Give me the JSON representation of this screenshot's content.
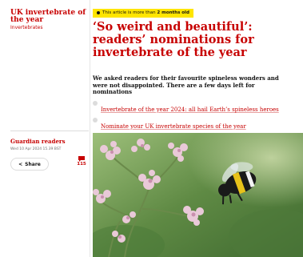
{
  "sidebar": {
    "series_title": "UK invertebrate of the year",
    "series_subtitle": "Invertebrates"
  },
  "meta": {
    "byline": "Guardian readers",
    "dateline": "Wed 10 Apr 2024 15.39 BST",
    "share_label": "Share",
    "share_icon": "share-icon",
    "comment_icon": "comment-icon",
    "comment_count": "115"
  },
  "article": {
    "notice": {
      "prefix": "This article is more than ",
      "emphasis": "2 months old"
    },
    "headline": "‘So weird and beautiful’: readers’ nominations for invertebrate of the year",
    "standfirst": "We asked readers for their favourite spineless wonders and were not disappointed. There are a few days left for nominations",
    "related_links": [
      {
        "label": "Invertebrate of the year 2024: all hail Earth’s spineless heroes"
      },
      {
        "label": "Nominate your UK invertebrate species of the year"
      }
    ]
  },
  "colors": {
    "accent": "#c70000",
    "notice_bg": "#ffe500",
    "text": "#121212"
  }
}
